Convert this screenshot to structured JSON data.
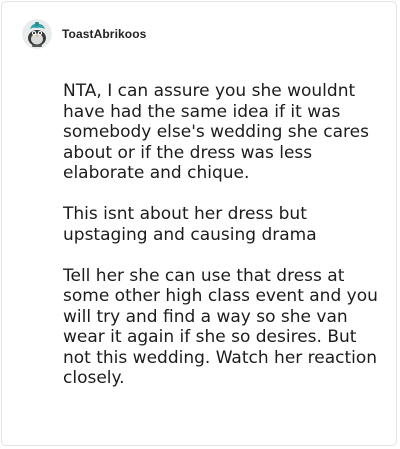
{
  "post": {
    "username": "ToastAbrikoos",
    "avatar_icon": "bird-icon",
    "paragraphs": [
      "NTA, I can assure you she wouldnt have had the same idea if it was somebody else's wedding she cares about or if the dress was less elaborate and chique.",
      "This isnt about her dress but upstaging and causing drama",
      "Tell her she can use that dress at some other high class event and you will try and find a way so she van wear it again if she so desires. But not this wedding. Watch her reaction closely."
    ]
  },
  "colors": {
    "border": "#e3e3e3",
    "text": "#1c1c1c",
    "avatar_accent": "#2fa3a8"
  }
}
